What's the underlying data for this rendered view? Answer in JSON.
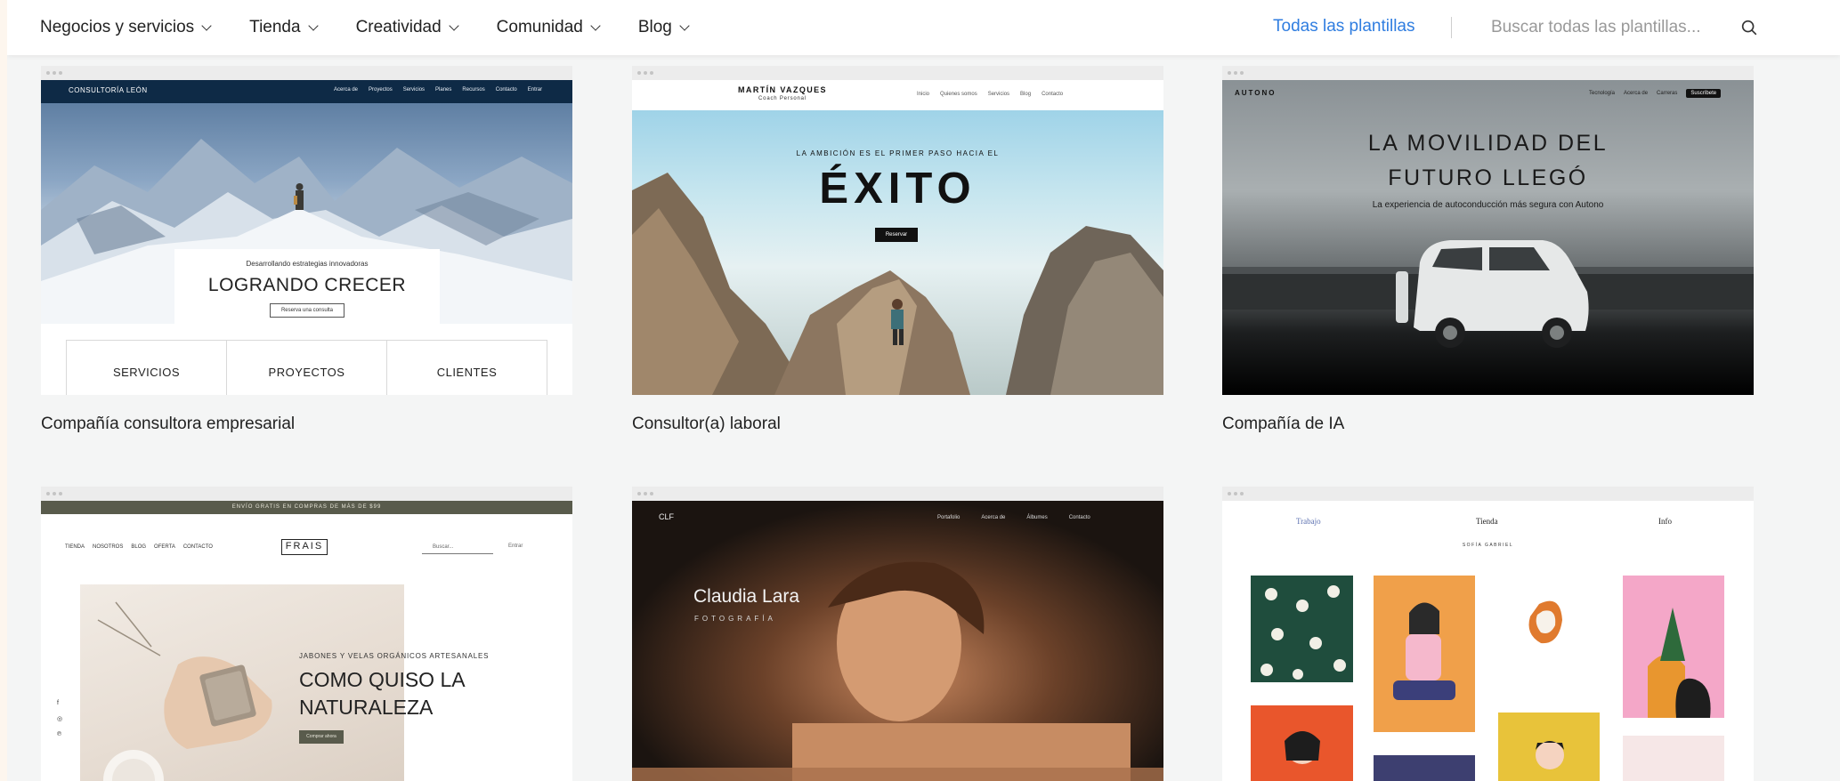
{
  "nav": {
    "menu": [
      {
        "label": "Negocios y servicios"
      },
      {
        "label": "Tienda"
      },
      {
        "label": "Creatividad"
      },
      {
        "label": "Comunidad"
      },
      {
        "label": "Blog"
      }
    ],
    "all_templates": "Todas las plantillas",
    "search_placeholder": "Buscar todas las plantillas..."
  },
  "cards": [
    {
      "title": "Compañía consultora empresarial",
      "preview": {
        "brand": "CONSULTORÍA LEÓN",
        "links": [
          "Acerca de",
          "Proyectos",
          "Servicios",
          "Planes",
          "Recursos",
          "Contacto",
          "Entrar"
        ],
        "subtitle": "Desarrollando estrategias innovadoras",
        "headline": "LOGRANDO CRECER",
        "button": "Reserva una consulta",
        "sections": [
          "SERVICIOS",
          "PROYECTOS",
          "CLIENTES"
        ]
      }
    },
    {
      "title": "Consultor(a) laboral",
      "preview": {
        "brand": "MARTÍN VAZQUES",
        "brand_sub": "Coach Personal",
        "links": [
          "Inicio",
          "Quienes somos",
          "Servicios",
          "Blog",
          "Contacto"
        ],
        "kicker": "LA AMBICIÓN ES EL PRIMER PASO HACIA EL",
        "headline": "ÉXITO",
        "button": "Reservar"
      }
    },
    {
      "title": "Compañía de IA",
      "preview": {
        "brand": "AUTONO",
        "links": [
          "Tecnología",
          "Acerca de",
          "Carreras"
        ],
        "cta": "Suscríbete",
        "headline_1": "LA MOVILIDAD DEL",
        "headline_2": "FUTURO LLEGÓ",
        "subtitle": "La experiencia de autoconducción más segura con Autono"
      }
    },
    {
      "title": "",
      "preview": {
        "banner": "ENVÍO GRATIS EN COMPRAS DE MÁS DE $99",
        "links": [
          "TIENDA",
          "NOSOTROS",
          "BLOG",
          "OFERTA",
          "CONTACTO"
        ],
        "logo": "FRAIS",
        "search": "Buscar...",
        "enter": "Entrar",
        "kicker": "JABONES Y VELAS ORGÁNICOS ARTESANALES",
        "headline": "COMO QUISO LA NATURALEZA",
        "button": "Comprar ahora"
      }
    },
    {
      "title": "",
      "preview": {
        "brand": "CLF",
        "links": [
          "Portafolio",
          "Acerca de",
          "Álbumes",
          "Contacto"
        ],
        "name": "Claudia Lara",
        "role": "FOTOGRAFÍA"
      }
    },
    {
      "title": "",
      "preview": {
        "links": [
          "Trabajo",
          "Tienda",
          "Info"
        ],
        "name": "SOFÍA GABRIEL"
      }
    }
  ]
}
